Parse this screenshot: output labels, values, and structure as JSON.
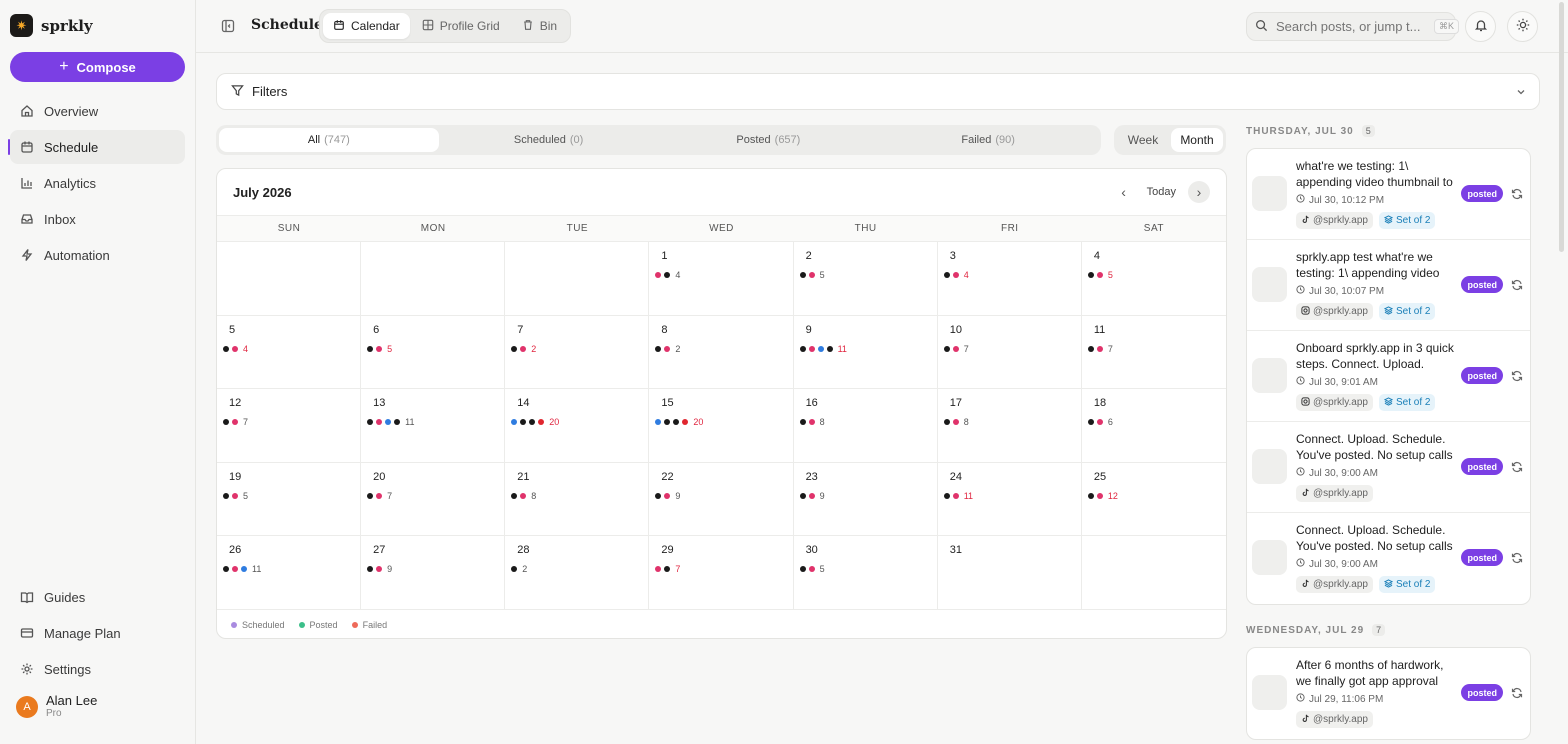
{
  "brand": {
    "name": "sprkly",
    "logo_icon": "sparkle-icon"
  },
  "compose": {
    "label": "Compose"
  },
  "nav": {
    "items": [
      {
        "label": "Overview",
        "icon": "home-icon",
        "active": false
      },
      {
        "label": "Schedule",
        "icon": "calendar-icon",
        "active": true
      },
      {
        "label": "Analytics",
        "icon": "bar-chart-icon",
        "active": false
      },
      {
        "label": "Inbox",
        "icon": "inbox-icon",
        "active": false
      },
      {
        "label": "Automation",
        "icon": "lightning-icon",
        "active": false
      }
    ],
    "bottom": [
      {
        "label": "Guides",
        "icon": "book-icon"
      },
      {
        "label": "Manage Plan",
        "icon": "card-icon"
      },
      {
        "label": "Settings",
        "icon": "gear-icon"
      }
    ]
  },
  "user": {
    "name": "Alan Lee",
    "plan": "Pro",
    "initial": "A"
  },
  "header": {
    "title": "Schedule",
    "view_tabs": [
      {
        "label": "Calendar",
        "icon": "calendar-icon",
        "active": true
      },
      {
        "label": "Profile Grid",
        "icon": "grid-icon",
        "active": false
      },
      {
        "label": "Bin",
        "icon": "trash-icon",
        "active": false
      }
    ],
    "search_placeholder": "Search posts, or jump t...",
    "search_shortcut": "⌘K"
  },
  "filters": {
    "label": "Filters"
  },
  "status_tabs": [
    {
      "label": "All",
      "count": "(747)",
      "active": true
    },
    {
      "label": "Scheduled",
      "count": "(0)",
      "active": false
    },
    {
      "label": "Posted",
      "count": "(657)",
      "active": false
    },
    {
      "label": "Failed",
      "count": "(90)",
      "active": false
    }
  ],
  "range_tabs": [
    {
      "label": "Week",
      "active": false
    },
    {
      "label": "Month",
      "active": true
    }
  ],
  "calendar": {
    "month_label": "July 2026",
    "today_label": "Today",
    "weekdays": [
      "SUN",
      "MON",
      "TUE",
      "WED",
      "THU",
      "FRI",
      "SAT"
    ],
    "dot_colors": {
      "k": "#1a1a1a",
      "p": "#e0336b",
      "b": "#2f7ce0",
      "r": "#e0262f"
    },
    "cells": [
      {
        "day": "",
        "dots": "",
        "count": "",
        "red": false
      },
      {
        "day": "",
        "dots": "",
        "count": "",
        "red": false
      },
      {
        "day": "",
        "dots": "",
        "count": "",
        "red": false
      },
      {
        "day": "1",
        "dots": "pk",
        "count": "4",
        "red": false
      },
      {
        "day": "2",
        "dots": "kp",
        "count": "5",
        "red": false
      },
      {
        "day": "3",
        "dots": "kp",
        "count": "4",
        "red": true
      },
      {
        "day": "4",
        "dots": "kp",
        "count": "5",
        "red": true
      },
      {
        "day": "5",
        "dots": "kp",
        "count": "4",
        "red": true
      },
      {
        "day": "6",
        "dots": "kp",
        "count": "5",
        "red": true
      },
      {
        "day": "7",
        "dots": "kp",
        "count": "2",
        "red": true
      },
      {
        "day": "8",
        "dots": "kp",
        "count": "2",
        "red": false
      },
      {
        "day": "9",
        "dots": "kpbk",
        "count": "11",
        "red": true
      },
      {
        "day": "10",
        "dots": "kp",
        "count": "7",
        "red": false
      },
      {
        "day": "11",
        "dots": "kp",
        "count": "7",
        "red": false
      },
      {
        "day": "12",
        "dots": "kp",
        "count": "7",
        "red": false
      },
      {
        "day": "13",
        "dots": "kpbk",
        "count": "11",
        "red": false
      },
      {
        "day": "14",
        "dots": "bkkr",
        "count": "20",
        "red": true
      },
      {
        "day": "15",
        "dots": "bkkr",
        "count": "20",
        "red": true
      },
      {
        "day": "16",
        "dots": "kp",
        "count": "8",
        "red": false
      },
      {
        "day": "17",
        "dots": "kp",
        "count": "8",
        "red": false
      },
      {
        "day": "18",
        "dots": "kp",
        "count": "6",
        "red": false
      },
      {
        "day": "19",
        "dots": "kp",
        "count": "5",
        "red": false
      },
      {
        "day": "20",
        "dots": "kp",
        "count": "7",
        "red": false
      },
      {
        "day": "21",
        "dots": "kp",
        "count": "8",
        "red": false
      },
      {
        "day": "22",
        "dots": "kp",
        "count": "9",
        "red": false
      },
      {
        "day": "23",
        "dots": "kp",
        "count": "9",
        "red": false
      },
      {
        "day": "24",
        "dots": "kp",
        "count": "11",
        "red": true
      },
      {
        "day": "25",
        "dots": "kp",
        "count": "12",
        "red": true
      },
      {
        "day": "26",
        "dots": "kpb",
        "count": "11",
        "red": false
      },
      {
        "day": "27",
        "dots": "kp",
        "count": "9",
        "red": false
      },
      {
        "day": "28",
        "dots": "k",
        "count": "2",
        "red": false
      },
      {
        "day": "29",
        "dots": "pk",
        "count": "7",
        "red": true
      },
      {
        "day": "30",
        "dots": "kp",
        "count": "5",
        "red": false
      },
      {
        "day": "31",
        "dots": "",
        "count": "",
        "red": false
      },
      {
        "day": "",
        "dots": "",
        "count": "",
        "red": false
      }
    ],
    "legend": [
      {
        "label": "Scheduled",
        "color": "#a98be0"
      },
      {
        "label": "Posted",
        "color": "#3cbf8a"
      },
      {
        "label": "Failed",
        "color": "#ee6a5a"
      }
    ]
  },
  "feed": {
    "days": [
      {
        "label": "THURSDAY, JUL 30",
        "count": "5",
        "posts": [
          {
            "text": "what're we testing: 1\\ appending video thumbnail to the post",
            "time": "Jul 30, 10:12 PM",
            "platform": "tiktok-icon",
            "handle": "@sprkly.app",
            "set": "Set of 2",
            "status": "posted"
          },
          {
            "text": "sprkly.app test what're we testing: 1\\ appending video thumbnail",
            "time": "Jul 30, 10:07 PM",
            "platform": "instagram-icon",
            "handle": "@sprkly.app",
            "set": "Set of 2",
            "status": "posted"
          },
          {
            "text": "Onboard sprkly.app in 3 quick steps. Connect. Upload. Schedule.",
            "time": "Jul 30, 9:01 AM",
            "platform": "instagram-icon",
            "handle": "@sprkly.app",
            "set": "Set of 2",
            "status": "posted"
          },
          {
            "text": "Connect. Upload. Schedule. You've posted. No setup calls needed.",
            "time": "Jul 30, 9:00 AM",
            "platform": "tiktok-icon",
            "handle": "@sprkly.app",
            "set": "",
            "status": "posted"
          },
          {
            "text": "Connect. Upload. Schedule. You've posted. No setup calls needed.",
            "time": "Jul 30, 9:00 AM",
            "platform": "tiktok-icon",
            "handle": "@sprkly.app",
            "set": "Set of 2",
            "status": "posted"
          }
        ]
      },
      {
        "label": "WEDNESDAY, JUL 29",
        "count": "7",
        "posts": [
          {
            "text": "After 6 months of hardwork, we finally got app approval from",
            "time": "Jul 29, 11:06 PM",
            "platform": "tiktok-icon",
            "handle": "@sprkly.app",
            "set": "",
            "status": "posted"
          }
        ]
      }
    ]
  }
}
